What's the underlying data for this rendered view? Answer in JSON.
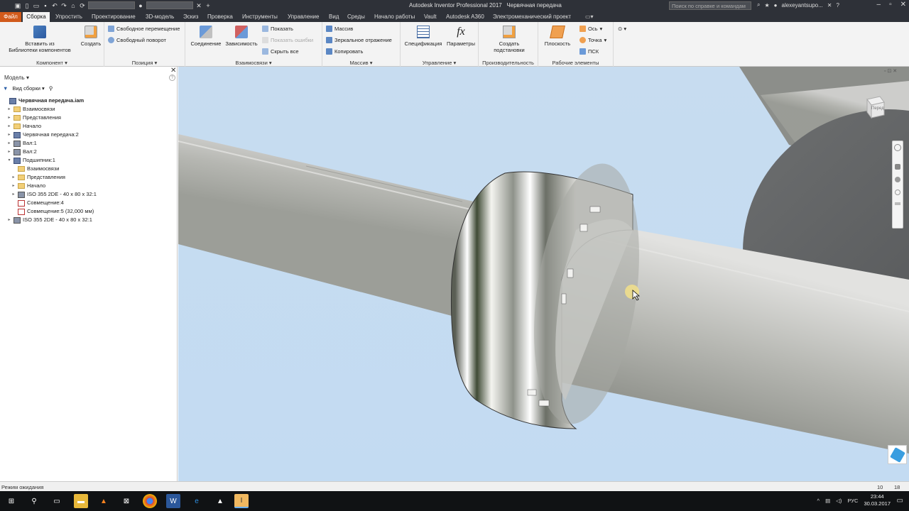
{
  "window": {
    "app_title": "Autodesk Inventor Professional 2017",
    "doc_title": "Червячная передача",
    "search_placeholder": "Поиск по справке и командам",
    "username": "alexeyantsupo..."
  },
  "tabs": [
    "Файл",
    "Сборка",
    "Упростить",
    "Проектирование",
    "3D-модель",
    "Эскиз",
    "Проверка",
    "Инструменты",
    "Управление",
    "Вид",
    "Среды",
    "Начало работы",
    "Vault",
    "Autodesk A360",
    "Электромеханический проект"
  ],
  "ribbon": {
    "component": {
      "title": "Компонент",
      "insert": "Вставить из\nБиблиотеки компонентов",
      "create": "Создать"
    },
    "position": {
      "title": "Позиция",
      "free_move": "Свободное перемещение",
      "free_rotate": "Свободный поворот"
    },
    "relations": {
      "title": "Взаимосвязи",
      "joint": "Соединение",
      "constraint": "Зависимость",
      "show": "Показать",
      "show_errors": "Показать ошибки",
      "hide_all": "Скрыть все"
    },
    "pattern": {
      "title": "Массив",
      "pattern": "Массив",
      "mirror": "Зеркальное отражение",
      "copy": "Копировать"
    },
    "manage": {
      "title": "Управление",
      "bom": "Спецификация",
      "params": "Параметры"
    },
    "productivity": {
      "title": "Производительность",
      "substitute": "Создать\nподстановки"
    },
    "work": {
      "title": "Рабочие элементы",
      "plane": "Плоскость",
      "axis": "Ось",
      "point": "Точка",
      "ucs": "ПСК"
    }
  },
  "browser": {
    "title": "Модель",
    "view": "Вид сборки",
    "tree": [
      {
        "label": "Червячная передача.iam",
        "level": 0,
        "icon": "assembly",
        "bold": true,
        "expand": ""
      },
      {
        "label": "Взаимосвязи",
        "level": 1,
        "icon": "folder",
        "expand": "▸"
      },
      {
        "label": "Представления",
        "level": 1,
        "icon": "folder",
        "expand": "▸"
      },
      {
        "label": "Начало",
        "level": 1,
        "icon": "folder",
        "expand": "▸"
      },
      {
        "label": "Червячная передача:2",
        "level": 1,
        "icon": "assembly",
        "expand": "▸"
      },
      {
        "label": "Вал:1",
        "level": 1,
        "icon": "part",
        "expand": "▸"
      },
      {
        "label": "Вал:2",
        "level": 1,
        "icon": "part",
        "expand": "▸"
      },
      {
        "label": "Подшипник:1",
        "level": 1,
        "icon": "assembly",
        "expand": "▾"
      },
      {
        "label": "Взаимосвязи",
        "level": 2,
        "icon": "folder",
        "expand": ""
      },
      {
        "label": "Представления",
        "level": 2,
        "icon": "folder",
        "expand": "▸"
      },
      {
        "label": "Начало",
        "level": 2,
        "icon": "folder",
        "expand": "▸"
      },
      {
        "label": "ISO 355 2DE - 40 x 80 x 32:1",
        "level": 2,
        "icon": "part",
        "expand": "▸"
      },
      {
        "label": "Совмещение:4",
        "level": 2,
        "icon": "constraint",
        "expand": ""
      },
      {
        "label": "Совмещение:5 (32,000 мм)",
        "level": 2,
        "icon": "constraint",
        "expand": ""
      },
      {
        "label": "ISO 355 2DE - 40 x 80 x 32:1",
        "level": 1,
        "icon": "part",
        "expand": "▸"
      }
    ]
  },
  "viewcube": {
    "face": "Перед"
  },
  "status": {
    "text": "Режим ожидания",
    "count1": "10",
    "count2": "18"
  },
  "taskbar": {
    "lang": "РУС",
    "time": "23:44",
    "date": "30.03.2017"
  }
}
